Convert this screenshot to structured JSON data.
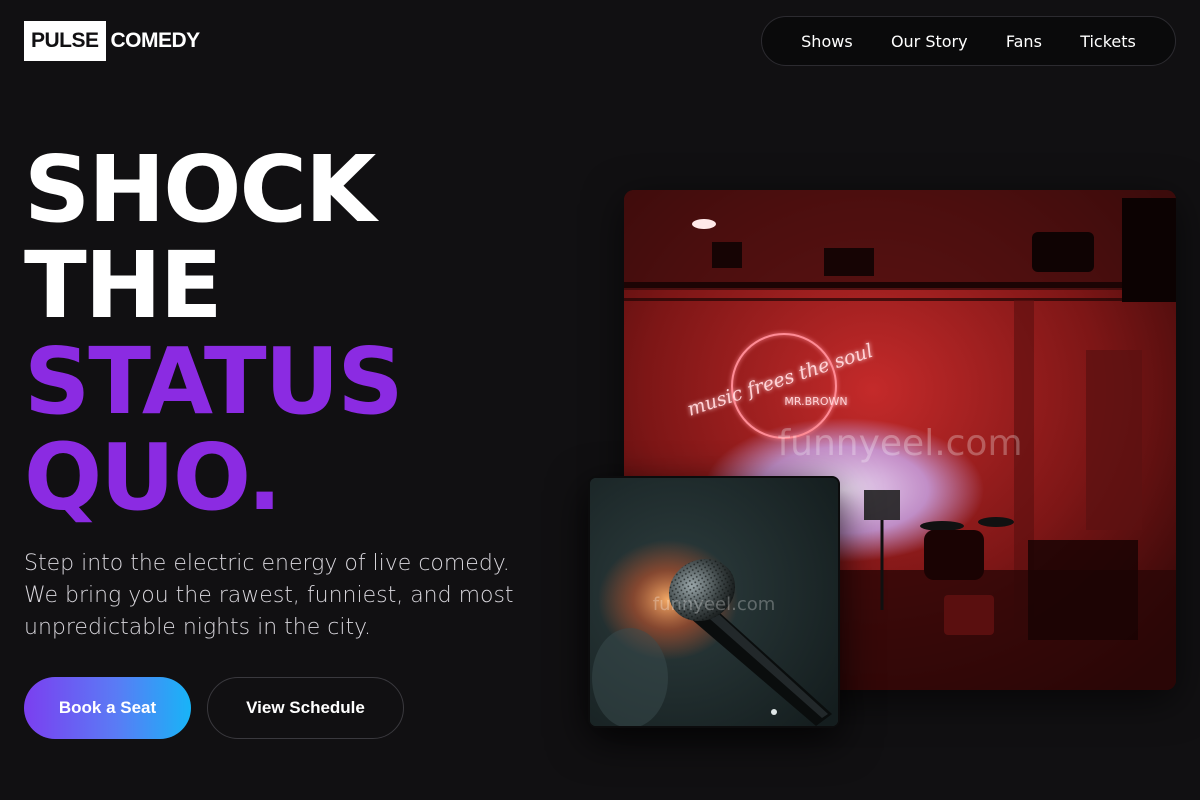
{
  "brand": {
    "logo_box": "PULSE",
    "logo_text": "COMEDY"
  },
  "nav": {
    "items": [
      {
        "label": "Shows"
      },
      {
        "label": "Our Story"
      },
      {
        "label": "Fans"
      },
      {
        "label": "Tickets"
      }
    ]
  },
  "hero": {
    "headline": [
      "SHOCK",
      "THE",
      "STATUS",
      "QUO."
    ],
    "subtext": "Step into the electric energy of live comedy. We bring you the rawest, funniest, and most unpredictable nights in the city.",
    "primary_button": "Book a Seat",
    "secondary_button": "View Schedule"
  },
  "images": {
    "stage": {
      "neon_line1": "music frees the soul",
      "neon_line2": "MR.BROWN",
      "watermark": "funnyeel.com"
    },
    "mic": {
      "watermark": "funnyeel.com"
    }
  },
  "colors": {
    "background": "#111012",
    "accent_purple": "#8b2be2",
    "gradient_start": "#7b3ff0",
    "gradient_end": "#18b4f7",
    "neon_red": "#ff5a6a"
  }
}
